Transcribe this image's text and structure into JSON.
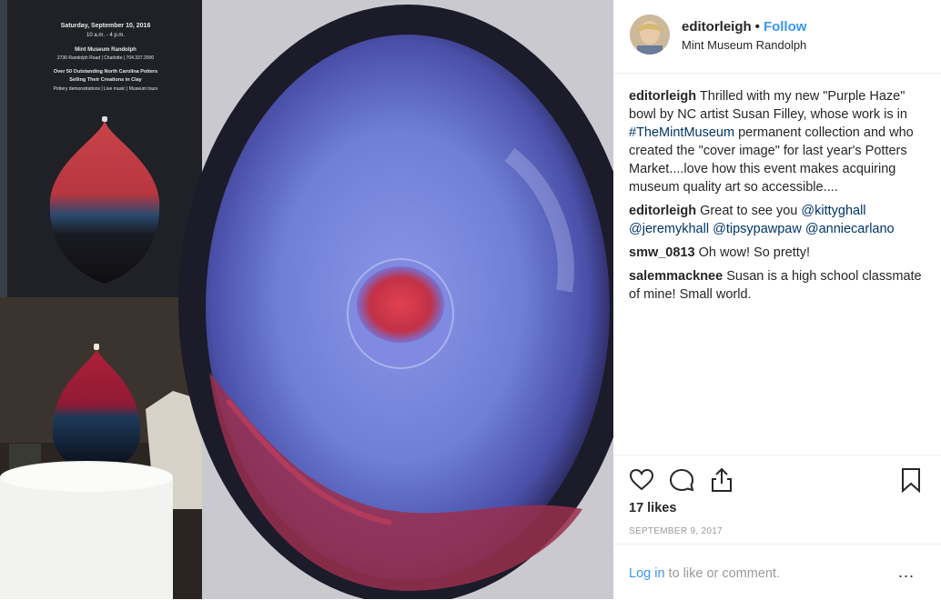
{
  "post": {
    "username": "editorleigh",
    "separator": "•",
    "follow_label": "Follow",
    "location": "Mint Museum Randolph"
  },
  "flyer": {
    "date_line": "Saturday, September 10, 2016",
    "time_line": "10 a.m. - 4 p.m.",
    "venue": "Mint Museum Randolph",
    "address": "2730 Randolph Road | Charlotte | 704.337.2000",
    "headline1": "Over 50 Outstanding North Carolina Potters",
    "headline2": "Selling Their Creations in Clay",
    "subline": "Pottery demonstrations | Live music | Museum tours"
  },
  "comments": [
    {
      "user": "editorleigh",
      "text_before": " Thrilled with my new \"Purple Haze\" bowl by NC artist Susan Filley, whose work is in ",
      "hashtag": "#TheMintMuseum",
      "text_after": " permanent collection and who created the \"cover image\" for last year's Potters Market....love how this event makes acquiring museum quality art so accessible...."
    },
    {
      "user": "editorleigh",
      "text": " Great to see you ",
      "mentions": [
        "@kittyghall",
        "@jeremykhall",
        "@tipsypawpaw",
        "@anniecarlano"
      ]
    },
    {
      "user": "smw_0813",
      "text": " Oh wow! So pretty!"
    },
    {
      "user": "salemmacknee",
      "text": " Susan is a high school classmate of mine! Small world."
    }
  ],
  "actions": {
    "icons": [
      "heart-icon",
      "comment-icon",
      "share-icon",
      "bookmark-icon"
    ],
    "likes": "17 likes",
    "date": "SEPTEMBER 9, 2017"
  },
  "footer": {
    "login_link": "Log in",
    "login_rest": " to like or comment.",
    "more": "..."
  },
  "colors": {
    "link": "#3897f0",
    "hashtag": "#003569",
    "bowl": "#6f7fd6",
    "glaze_red": "#b8304a"
  }
}
